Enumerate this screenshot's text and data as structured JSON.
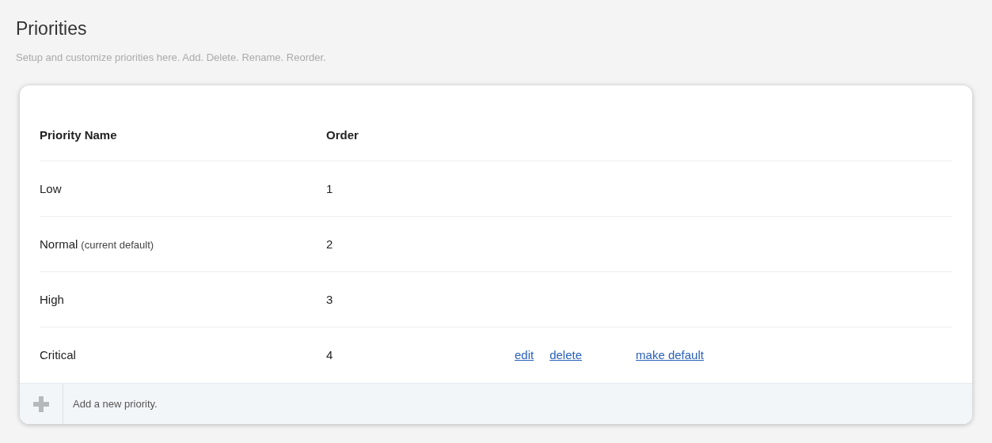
{
  "title": "Priorities",
  "subtitle": "Setup and customize priorities here. Add. Delete. Rename. Reorder.",
  "table": {
    "columns": [
      "Priority Name",
      "Order"
    ],
    "rows": [
      {
        "name": "Low",
        "order": "1"
      },
      {
        "name": "Normal",
        "note": "(current default)",
        "order": "2"
      },
      {
        "name": "High",
        "order": "3"
      },
      {
        "name": "Critical",
        "order": "4",
        "actions": [
          "edit",
          "delete",
          "make default"
        ]
      }
    ]
  },
  "add_row": {
    "label": "Add a new priority."
  }
}
